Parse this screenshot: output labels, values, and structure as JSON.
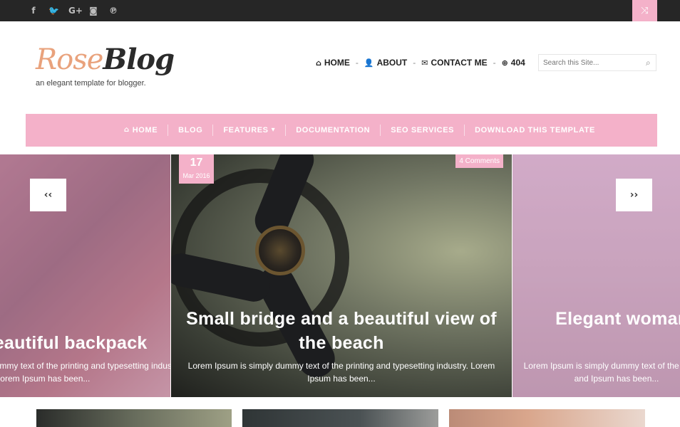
{
  "topbar": {
    "social": [
      {
        "icon": "facebook-icon",
        "glyph": "f"
      },
      {
        "icon": "twitter-icon",
        "glyph": "🐦"
      },
      {
        "icon": "google-plus-icon",
        "glyph": "G+"
      },
      {
        "icon": "instagram-icon",
        "glyph": "◙"
      },
      {
        "icon": "pinterest-icon",
        "glyph": "℗"
      }
    ],
    "shuffle_icon": "⤨",
    "accent": "#f4b1c9"
  },
  "header": {
    "logo_part1": "Rose",
    "logo_part2": "Blog",
    "tagline": "an elegant template for blogger.",
    "nav": [
      {
        "icon": "home-icon",
        "glyph": "⌂",
        "label": "HOME"
      },
      {
        "icon": "user-icon",
        "glyph": "👤",
        "label": "ABOUT"
      },
      {
        "icon": "envelope-icon",
        "glyph": "✉",
        "label": "CONTACT ME"
      },
      {
        "icon": "lifebuoy-icon",
        "glyph": "⊕",
        "label": "404"
      }
    ],
    "search_placeholder": "Search this Site...",
    "search_icon": "⌕"
  },
  "menu": {
    "items": [
      {
        "label": "HOME",
        "glyph": "⌂"
      },
      {
        "label": "BLOG"
      },
      {
        "label": "FEATURES",
        "caret": "▾"
      },
      {
        "label": "DOCUMENTATION"
      },
      {
        "label": "SEO SERVICES"
      },
      {
        "label": "DOWNLOAD THIS TEMPLATE"
      }
    ]
  },
  "slider": {
    "prev_label": "‹‹",
    "next_label": "››",
    "slides": [
      {
        "title": "Beautiful backpack",
        "excerpt": "Lorem Ipsum is simply dummy text of the printing and typesetting industry. Lorem Ipsum has been..."
      },
      {
        "title": "Small bridge and a beautiful view of the beach",
        "excerpt": "Lorem Ipsum is simply dummy text of the printing and typesetting industry. Lorem Ipsum has been...",
        "date_day": "17",
        "date_month": "Mar 2016",
        "comments": "4 Comments"
      },
      {
        "title": "Elegant woman with water",
        "excerpt": "Lorem Ipsum is simply dummy text of the printing and Ipsum has been..."
      }
    ]
  }
}
